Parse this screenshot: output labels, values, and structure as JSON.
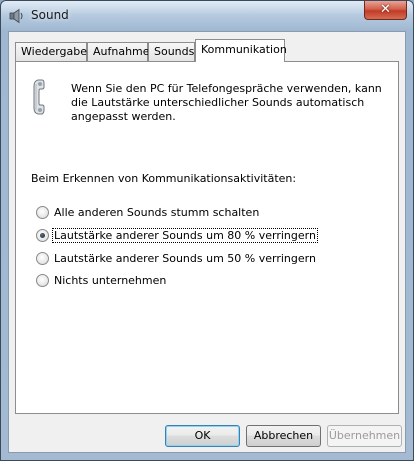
{
  "window": {
    "title": "Sound",
    "icon": "speaker-icon",
    "close_glyph": "✕"
  },
  "tabs": [
    {
      "label": "Wiedergabe",
      "active": false
    },
    {
      "label": "Aufnahme",
      "active": false
    },
    {
      "label": "Sounds",
      "active": false
    },
    {
      "label": "Kommunikation",
      "active": true
    }
  ],
  "communication": {
    "icon": "telephone-handset-icon",
    "intro": "Wenn Sie den PC für Telefongespräche verwenden, kann die Lautstärke unterschiedlicher Sounds automatisch angepasst werden.",
    "detect_label": "Beim Erkennen von Kommunikationsaktivitäten:",
    "options": [
      {
        "label": "Alle anderen Sounds stumm schalten",
        "checked": false
      },
      {
        "label": "Lautstärke anderer Sounds um 80 % verringern",
        "checked": true
      },
      {
        "label": "Lautstärke anderer Sounds um 50 % verringern",
        "checked": false
      },
      {
        "label": "Nichts unternehmen",
        "checked": false
      }
    ]
  },
  "buttons": {
    "ok": "OK",
    "cancel": "Abbrechen",
    "apply": "Übernehmen"
  }
}
